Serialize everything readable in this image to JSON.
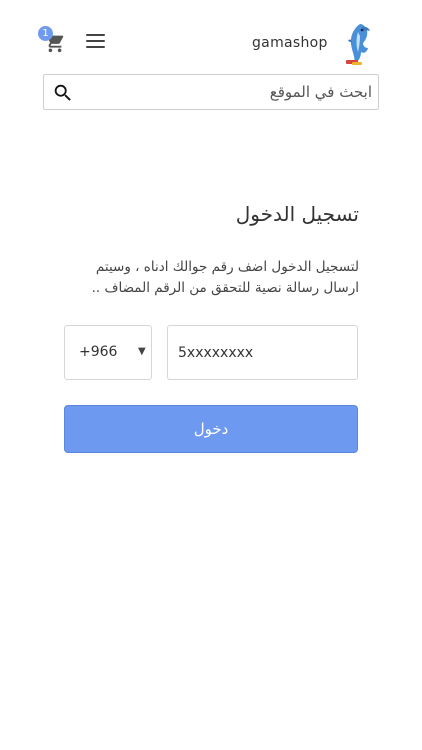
{
  "header": {
    "brand": "gamashop",
    "cart_count": "1"
  },
  "search": {
    "placeholder": "ابحث في الموقع"
  },
  "login": {
    "title": "تسجيل الدخول",
    "description": "لتسجيل الدخول اضف رقم جوالك ادناه ، وسيتم ارسال رسالة نصية للتحقق من الرقم المضاف ..",
    "country_code": "+966",
    "phone_placeholder": "5xxxxxxxx",
    "submit_label": "دخول"
  },
  "colors": {
    "accent": "#6d9af0"
  }
}
